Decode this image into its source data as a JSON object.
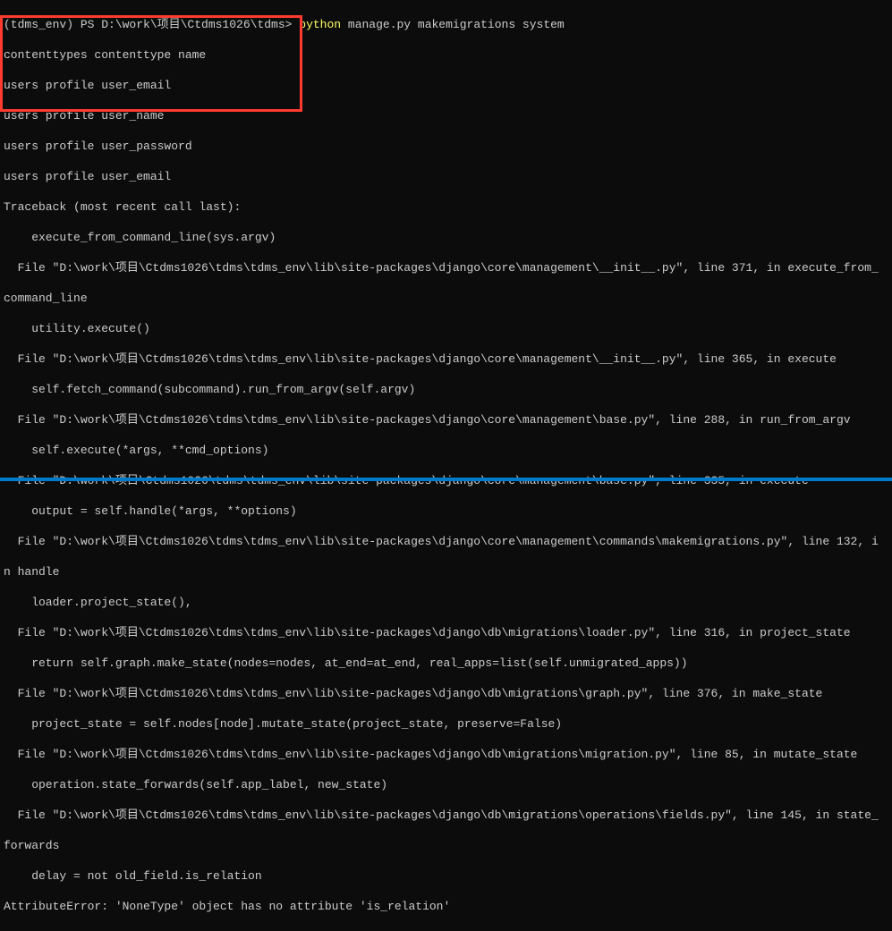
{
  "prompt": {
    "prefix": "(tdms_env) PS D:\\work\\项目\\Ctdms1026\\tdms>",
    "command_python": "python",
    "command_args": "manage.py makemigrations system"
  },
  "highlighted_output": [
    "contenttypes contenttype name",
    "users profile user_email",
    "users profile user_name",
    "users profile user_password",
    "users profile user_email",
    "Traceback (most recent call last):"
  ],
  "traceback": [
    "    execute_from_command_line(sys.argv)",
    "  File \"D:\\work\\项目\\Ctdms1026\\tdms\\tdms_env\\lib\\site-packages\\django\\core\\management\\__init__.py\", line 371, in execute_from_",
    "command_line",
    "    utility.execute()",
    "  File \"D:\\work\\项目\\Ctdms1026\\tdms\\tdms_env\\lib\\site-packages\\django\\core\\management\\__init__.py\", line 365, in execute",
    "    self.fetch_command(subcommand).run_from_argv(self.argv)",
    "  File \"D:\\work\\项目\\Ctdms1026\\tdms\\tdms_env\\lib\\site-packages\\django\\core\\management\\base.py\", line 288, in run_from_argv",
    "    self.execute(*args, **cmd_options)",
    "  File \"D:\\work\\项目\\Ctdms1026\\tdms\\tdms_env\\lib\\site-packages\\django\\core\\management\\base.py\", line 335, in execute",
    "    output = self.handle(*args, **options)",
    "  File \"D:\\work\\项目\\Ctdms1026\\tdms\\tdms_env\\lib\\site-packages\\django\\core\\management\\commands\\makemigrations.py\", line 132, i",
    "n handle",
    "    loader.project_state(),",
    "  File \"D:\\work\\项目\\Ctdms1026\\tdms\\tdms_env\\lib\\site-packages\\django\\db\\migrations\\loader.py\", line 316, in project_state",
    "    return self.graph.make_state(nodes=nodes, at_end=at_end, real_apps=list(self.unmigrated_apps))",
    "  File \"D:\\work\\项目\\Ctdms1026\\tdms\\tdms_env\\lib\\site-packages\\django\\db\\migrations\\graph.py\", line 376, in make_state",
    "    project_state = self.nodes[node].mutate_state(project_state, preserve=False)",
    "  File \"D:\\work\\项目\\Ctdms1026\\tdms\\tdms_env\\lib\\site-packages\\django\\db\\migrations\\migration.py\", line 85, in mutate_state",
    "    operation.state_forwards(self.app_label, new_state)",
    "  File \"D:\\work\\项目\\Ctdms1026\\tdms\\tdms_env\\lib\\site-packages\\django\\db\\migrations\\operations\\fields.py\", line 145, in state_",
    "forwards",
    "    delay = not old_field.is_relation",
    "AttributeError: 'NoneType' object has no attribute 'is_relation'"
  ]
}
